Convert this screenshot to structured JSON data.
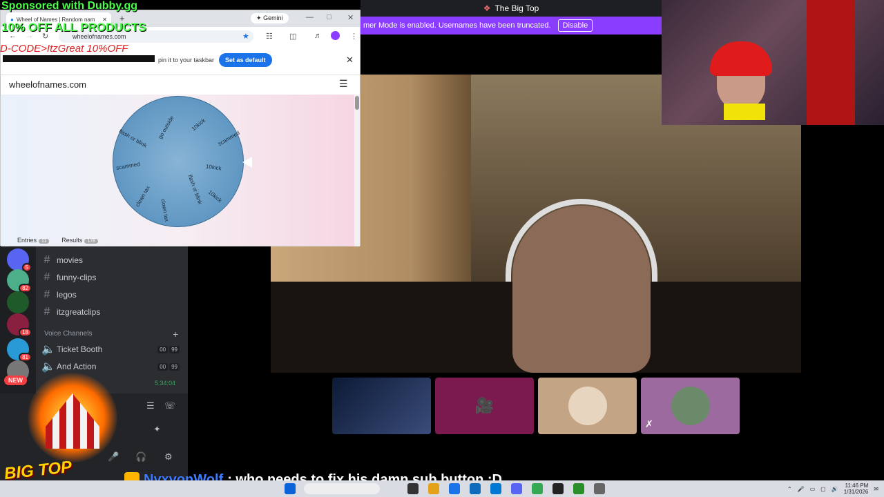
{
  "overlay": {
    "sponsor": "Sponsored with Dubby.gg",
    "promo": "10% OFF ALL PRODUCTS",
    "code": "D-CODE>ItzGreat 10%OFF",
    "logo_text": "BIG TOP",
    "chat_user": "NyxvonWolf",
    "chat_message": ": who needs to fix his damn sub button :D"
  },
  "browser": {
    "tab_title": "Wheel of Names | Random nam",
    "gemini_label": "Gemini",
    "url": "wheelofnames.com",
    "infobar_text": "pin it to your taskbar",
    "set_default_label": "Set as default",
    "site_name": "wheelofnames.com",
    "wheel_labels": [
      "go outside",
      "10kick",
      "scammed",
      "10kick",
      "flash or blink",
      "10kick",
      "clown tax",
      "scammed",
      "flash or blink",
      "clown tax"
    ],
    "tabs": [
      {
        "label": "Entries",
        "count": "11"
      },
      {
        "label": "Results",
        "count": "178"
      }
    ]
  },
  "discord": {
    "window_title": "The Big Top",
    "streamer_banner": "mer Mode is enabled. Usernames have been truncated.",
    "disable_label": "Disable",
    "new_badge": "NEW",
    "guild_badges": [
      "5",
      "82",
      "18",
      "81"
    ],
    "text_channels": [
      {
        "name": "movies"
      },
      {
        "name": "funny-clips"
      },
      {
        "name": "legos"
      },
      {
        "name": "itzgreatclips"
      }
    ],
    "voice_header": "Voice Channels",
    "voice_channels": [
      {
        "name": "Ticket Booth",
        "count_a": "00",
        "count_b": "99"
      },
      {
        "name": "And Action",
        "count_a": "00",
        "count_b": "99"
      }
    ],
    "voice_timer": "5:34:04"
  },
  "taskbar": {
    "time": "11:46 PM",
    "date": "1/31/2026"
  },
  "colors": {
    "discord_bg": "#2b2d31",
    "accent": "#8a3dff",
    "sponsor_green": "#4aff4a",
    "chat_blue": "#3b7cff"
  }
}
